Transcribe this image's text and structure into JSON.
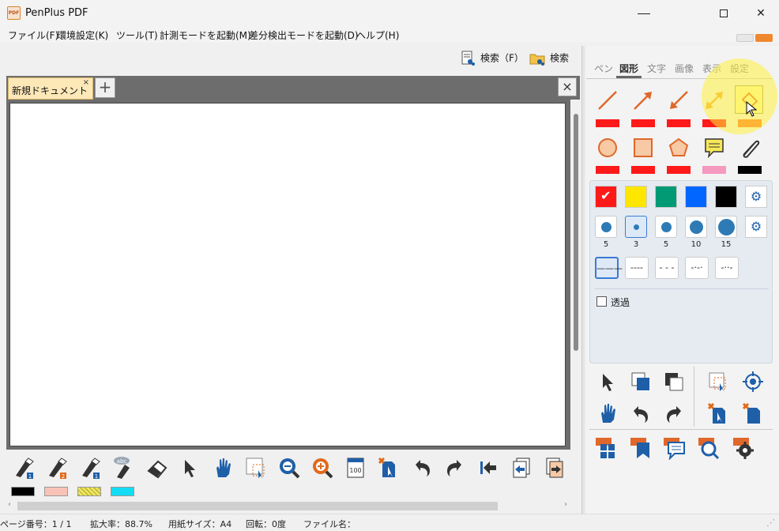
{
  "window": {
    "title": "PenPlus PDF",
    "app_icon_text": "PDF"
  },
  "menu": {
    "items": [
      "ファイル(F)",
      "環境設定(K)",
      "ツール(T)",
      "計測モードを起動(M)",
      "差分検出モードを起動(D)",
      "ヘルプ(H)"
    ]
  },
  "search": {
    "search_f_label": "検索（F）",
    "search_folder_label": "検索"
  },
  "tabs": {
    "doc_tab_label": "新規ドキュメント＊",
    "doc_tab_close": "×",
    "add_label": "+",
    "close_all_label": "×"
  },
  "bottom_colors": [
    "#000000",
    "#f8c3b6",
    "#f2ea7a",
    "#14dcf4"
  ],
  "panel": {
    "tabs": [
      "ペン",
      "図形",
      "文字",
      "画像",
      "表示",
      "設定"
    ],
    "active_tab": "図形",
    "shape_colors_row1": [
      "#ff1a1a",
      "#ff1a1a",
      "#ff1a1a",
      "#ff1a1a",
      "#ff6a2a"
    ],
    "shape_colors_row2": [
      "#ff1a1a",
      "#ff1a1a",
      "#ff1a1a",
      "#f599c0",
      "#000000"
    ],
    "swatches": [
      "#ff1a1a",
      "#ffe600",
      "#009a75",
      "#0066ff",
      "#000000"
    ],
    "sizes": [
      "5",
      "3",
      "5",
      "10",
      "15"
    ],
    "selected_size_index": 1,
    "line_styles": [
      "———",
      "----",
      "- - -",
      "-·-·",
      "-··-"
    ],
    "transparent_label": "透過",
    "transparent_checked": false
  },
  "status": {
    "page": "ページ番号：1 / 1",
    "zoom": "拡大率：88.7%",
    "paper": "用紙サイズ：A4",
    "rotation": "回転：0度",
    "filename": "ファイル名："
  }
}
